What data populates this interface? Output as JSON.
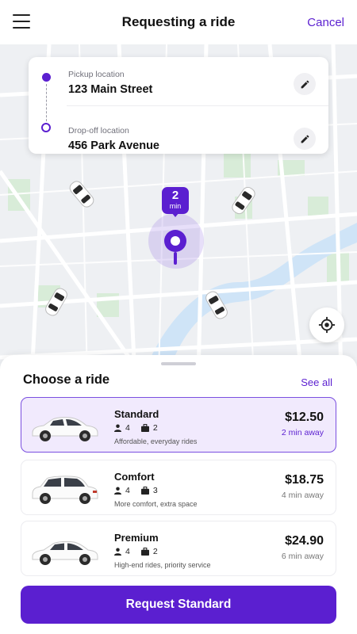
{
  "header": {
    "title": "Requesting a ride",
    "cancel_label": "Cancel",
    "menu_icon": "hamburger-menu-icon"
  },
  "route": {
    "pickup": {
      "label": "Pickup location",
      "value": "123 Main Street"
    },
    "dropoff": {
      "label": "Drop-off location",
      "value": "456 Park Avenue"
    },
    "edit_icon": "pencil-icon"
  },
  "map": {
    "eta_value": "2",
    "eta_unit": "min",
    "locate_icon": "crosshair-icon",
    "nearby_cars": 4
  },
  "sheet": {
    "title": "Choose a ride",
    "see_all_label": "See all",
    "rides": [
      {
        "name": "Standard",
        "seats": "4",
        "bags": "2",
        "description": "Affordable, everyday rides",
        "price": "$12.50",
        "eta": "2 min away",
        "selected": true,
        "car_color": "white"
      },
      {
        "name": "Comfort",
        "seats": "4",
        "bags": "3",
        "description": "More comfort, extra space",
        "price": "$18.75",
        "eta": "4 min away",
        "selected": false,
        "car_color": "white"
      },
      {
        "name": "Premium",
        "seats": "4",
        "bags": "2",
        "description": "High-end rides, priority service",
        "price": "$24.90",
        "eta": "6 min away",
        "selected": false,
        "car_color": "white"
      }
    ]
  },
  "request_button_label": "Request Standard",
  "colors": {
    "accent": "#5b1fd0",
    "selected_bg": "#f1eafd",
    "map_bg": "#eef0f3",
    "water": "#cfe4f7",
    "park": "#d8ecd8"
  }
}
